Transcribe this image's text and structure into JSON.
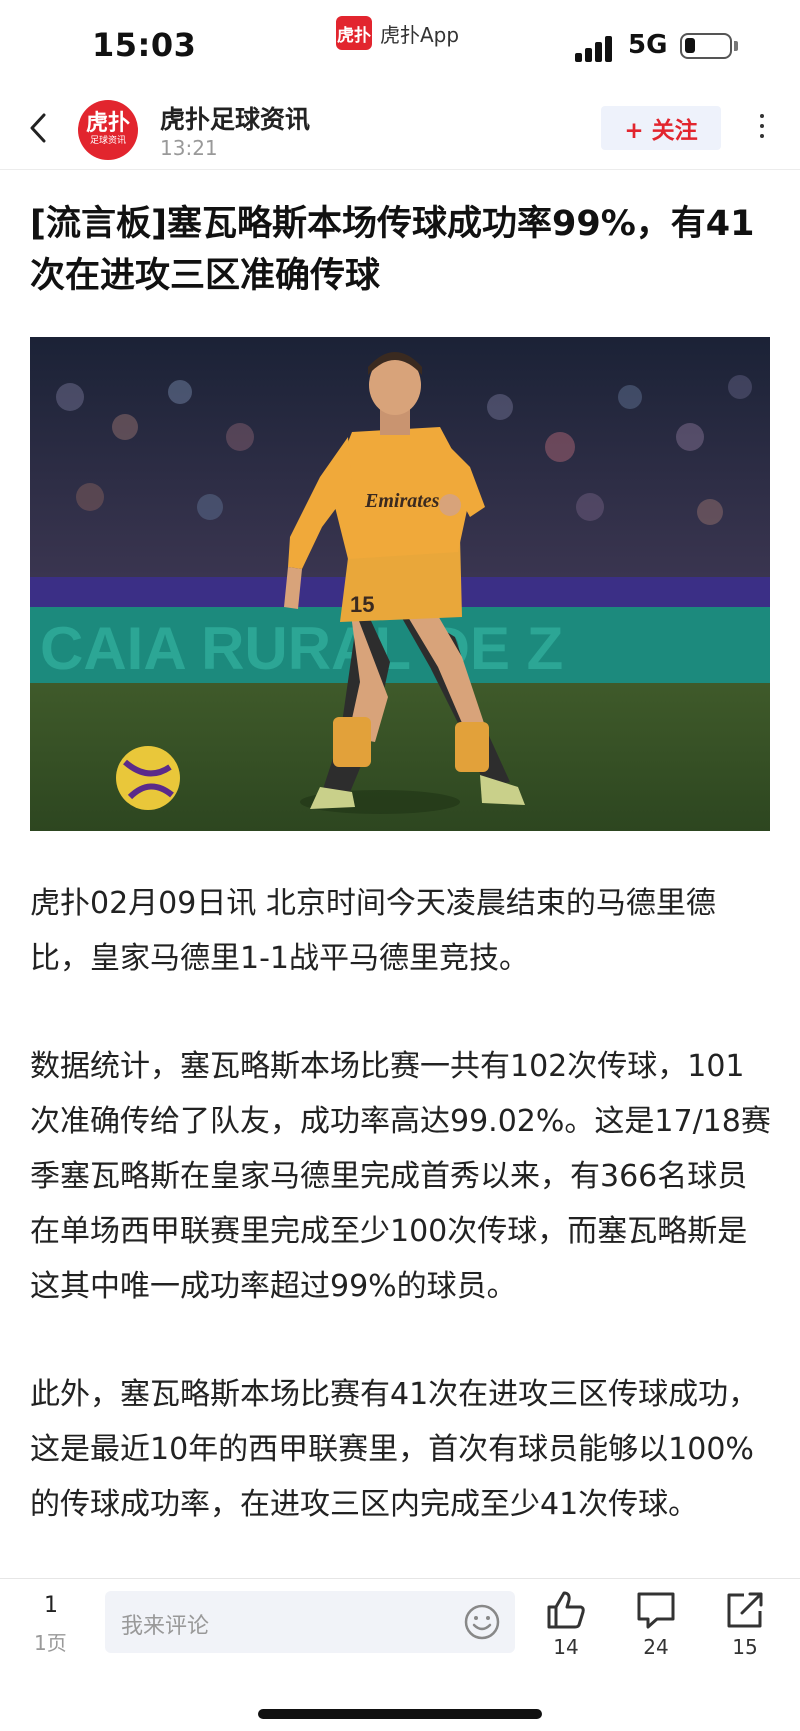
{
  "status_bar": {
    "time": "15:03",
    "app_logo": "虎扑",
    "app_name": "虎扑App",
    "network": "5G"
  },
  "header": {
    "author_name": "虎扑足球资讯",
    "post_time": "13:21",
    "avatar_text_top": "虎扑",
    "avatar_text_bottom": "足球资讯",
    "follow_label": "+ 关注"
  },
  "article": {
    "title": "[流言板]塞瓦略斯本场传球成功率99%，有41次在进攻三区准确传球",
    "paragraphs": [
      "虎扑02月09日讯 北京时间今天凌晨结束的马德里德比，皇家马德里1-1战平马德里竞技。",
      "数据统计，塞瓦略斯本场比赛一共有102次传球，101次准确传给了队友，成功率高达99.02%。这是17/18赛季塞瓦略斯在皇家马德里完成首秀以来，有366名球员在单场西甲联赛里完成至少100次传球，而塞瓦略斯是这其中唯一成功率超过99%的球员。",
      "此外，塞瓦略斯本场比赛有41次在进攻三区传球成功，这是最近10年的西甲联赛里，首次有球员能够以100%的传球成功率，在进攻三区内完成至少41次传球。"
    ],
    "image": {
      "shirt_sponsor": "Emirates",
      "shirt_number": "15",
      "board_text": "CAIA RURAL DE Z"
    }
  },
  "bottom_bar": {
    "page_number": "1",
    "page_label": "1页",
    "comment_placeholder": "我来评论",
    "like_count": "14",
    "comment_count": "24",
    "share_count": "15"
  }
}
